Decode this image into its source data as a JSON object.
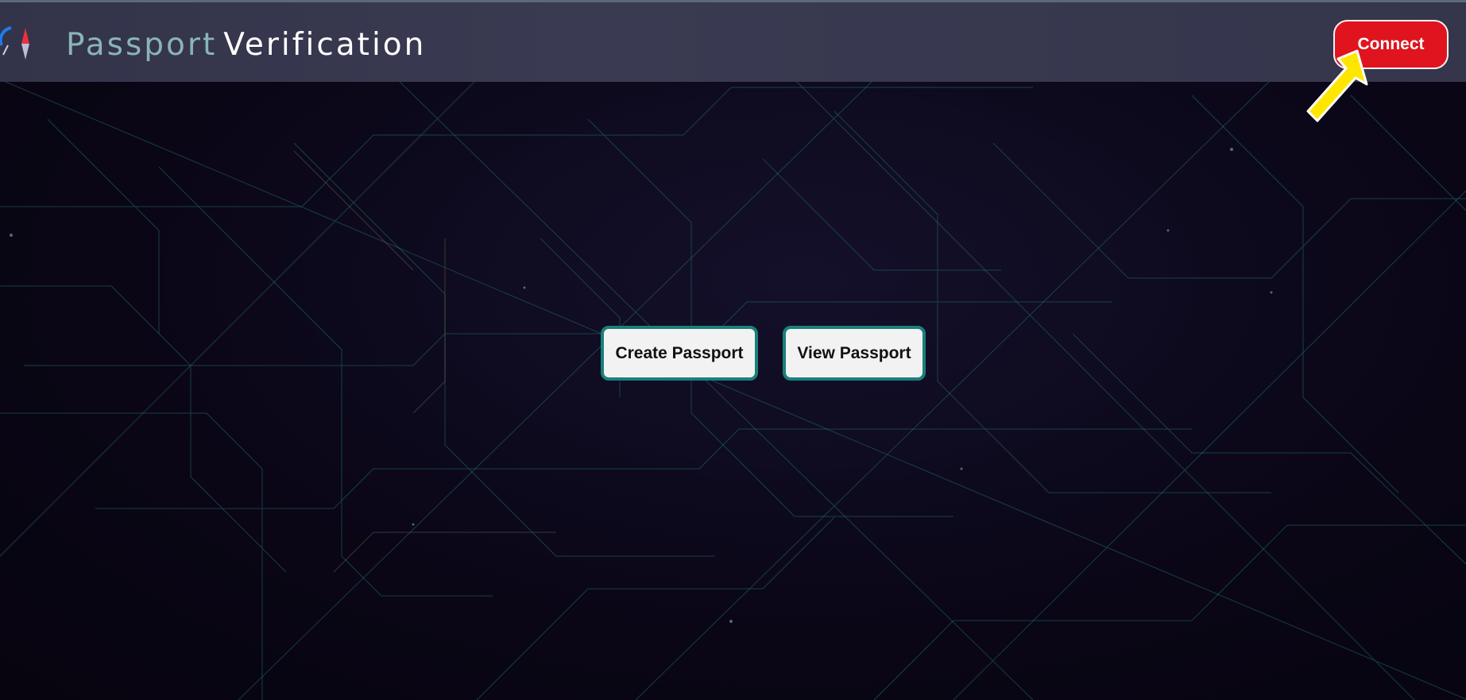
{
  "header": {
    "brand_part1": "Passport",
    "brand_part2": "Verification",
    "connect_label": "Connect"
  },
  "main": {
    "create_label": "Create Passport",
    "view_label": "View Passport"
  },
  "colors": {
    "connect_bg": "#e0141e",
    "action_border": "#1a7f7a",
    "arrow": "#ffe600",
    "header_bg": "#35354c",
    "page_bg": "#0c0718"
  },
  "icons": {
    "logo": "compass-logo-icon",
    "pointer": "yellow-arrow-icon"
  }
}
